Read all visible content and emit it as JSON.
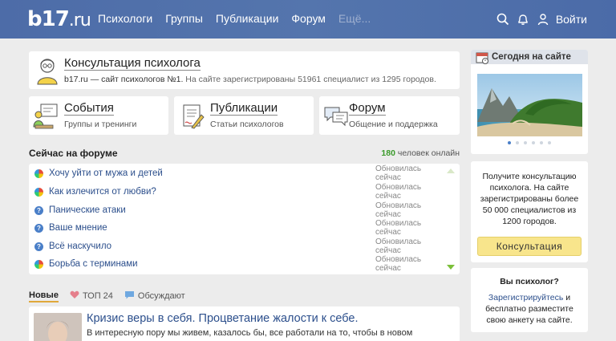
{
  "header": {
    "logo_main": "b17",
    "logo_suffix": ".ru",
    "nav": [
      "Психологи",
      "Группы",
      "Публикации",
      "Форум"
    ],
    "nav_more": "Ещё...",
    "login_label": "Войти",
    "icons": [
      "search-icon",
      "bell-icon",
      "user-icon"
    ]
  },
  "consult_card": {
    "title": "Консультация психолога",
    "subtitle_site": "b17.ru — сайт психологов №1.",
    "subtitle_stats": "На сайте зарегистрированы 51961 специалист из 1295 городов."
  },
  "features": [
    {
      "title": "События",
      "subtitle": "Группы и тренинги",
      "icon": "events-icon"
    },
    {
      "title": "Публикации",
      "subtitle": "Статьи психологов",
      "icon": "publications-icon"
    },
    {
      "title": "Форум",
      "subtitle": "Общение и поддержка",
      "icon": "forum-icon"
    }
  ],
  "forum": {
    "heading": "Сейчас на форуме",
    "online_count": "180",
    "online_label": "человек онлайн",
    "topics": [
      {
        "title": "Хочу уйти от мужа и детей",
        "status": "Обновилась сейчас",
        "icon": "colorful-topic-icon"
      },
      {
        "title": "Как излечится от любви?",
        "status": "Обновилась сейчас",
        "icon": "colorful-topic-icon"
      },
      {
        "title": "Панические атаки",
        "status": "Обновилась сейчас",
        "icon": "question-icon"
      },
      {
        "title": "Ваше мнение",
        "status": "Обновилась сейчас",
        "icon": "question-icon"
      },
      {
        "title": "Всё наскучило",
        "status": "Обновилась сейчас",
        "icon": "question-icon"
      },
      {
        "title": "Борьба с терминами",
        "status": "Обновилась сейчас",
        "icon": "colorful-topic-icon"
      }
    ]
  },
  "tabs": {
    "active": "Новые",
    "top": "ТОП 24",
    "discuss": "Обсуждают"
  },
  "article": {
    "title": "Кризис веры в себя. Процветание жалости к себе.",
    "excerpt": "В интересную пору мы живем, казалось бы, все работали на то, чтобы в новом"
  },
  "sidebar": {
    "today_title": "Сегодня на сайте",
    "consult_text": "Получите консультацию психолога. На сайте зарегистрированы более 50 000 специалистов из 1200 городов.",
    "consult_button": "Консультация",
    "psy_question": "Вы психолог?",
    "psy_link": "Зарегистрируйтесь",
    "psy_rest": "и бесплатно разместите свою анкету на сайте."
  },
  "colors": {
    "header_bg": "#4a6aa6",
    "link": "#2c4f8c",
    "online_green": "#3a9a2a",
    "button_yellow": "#f8e58c"
  }
}
